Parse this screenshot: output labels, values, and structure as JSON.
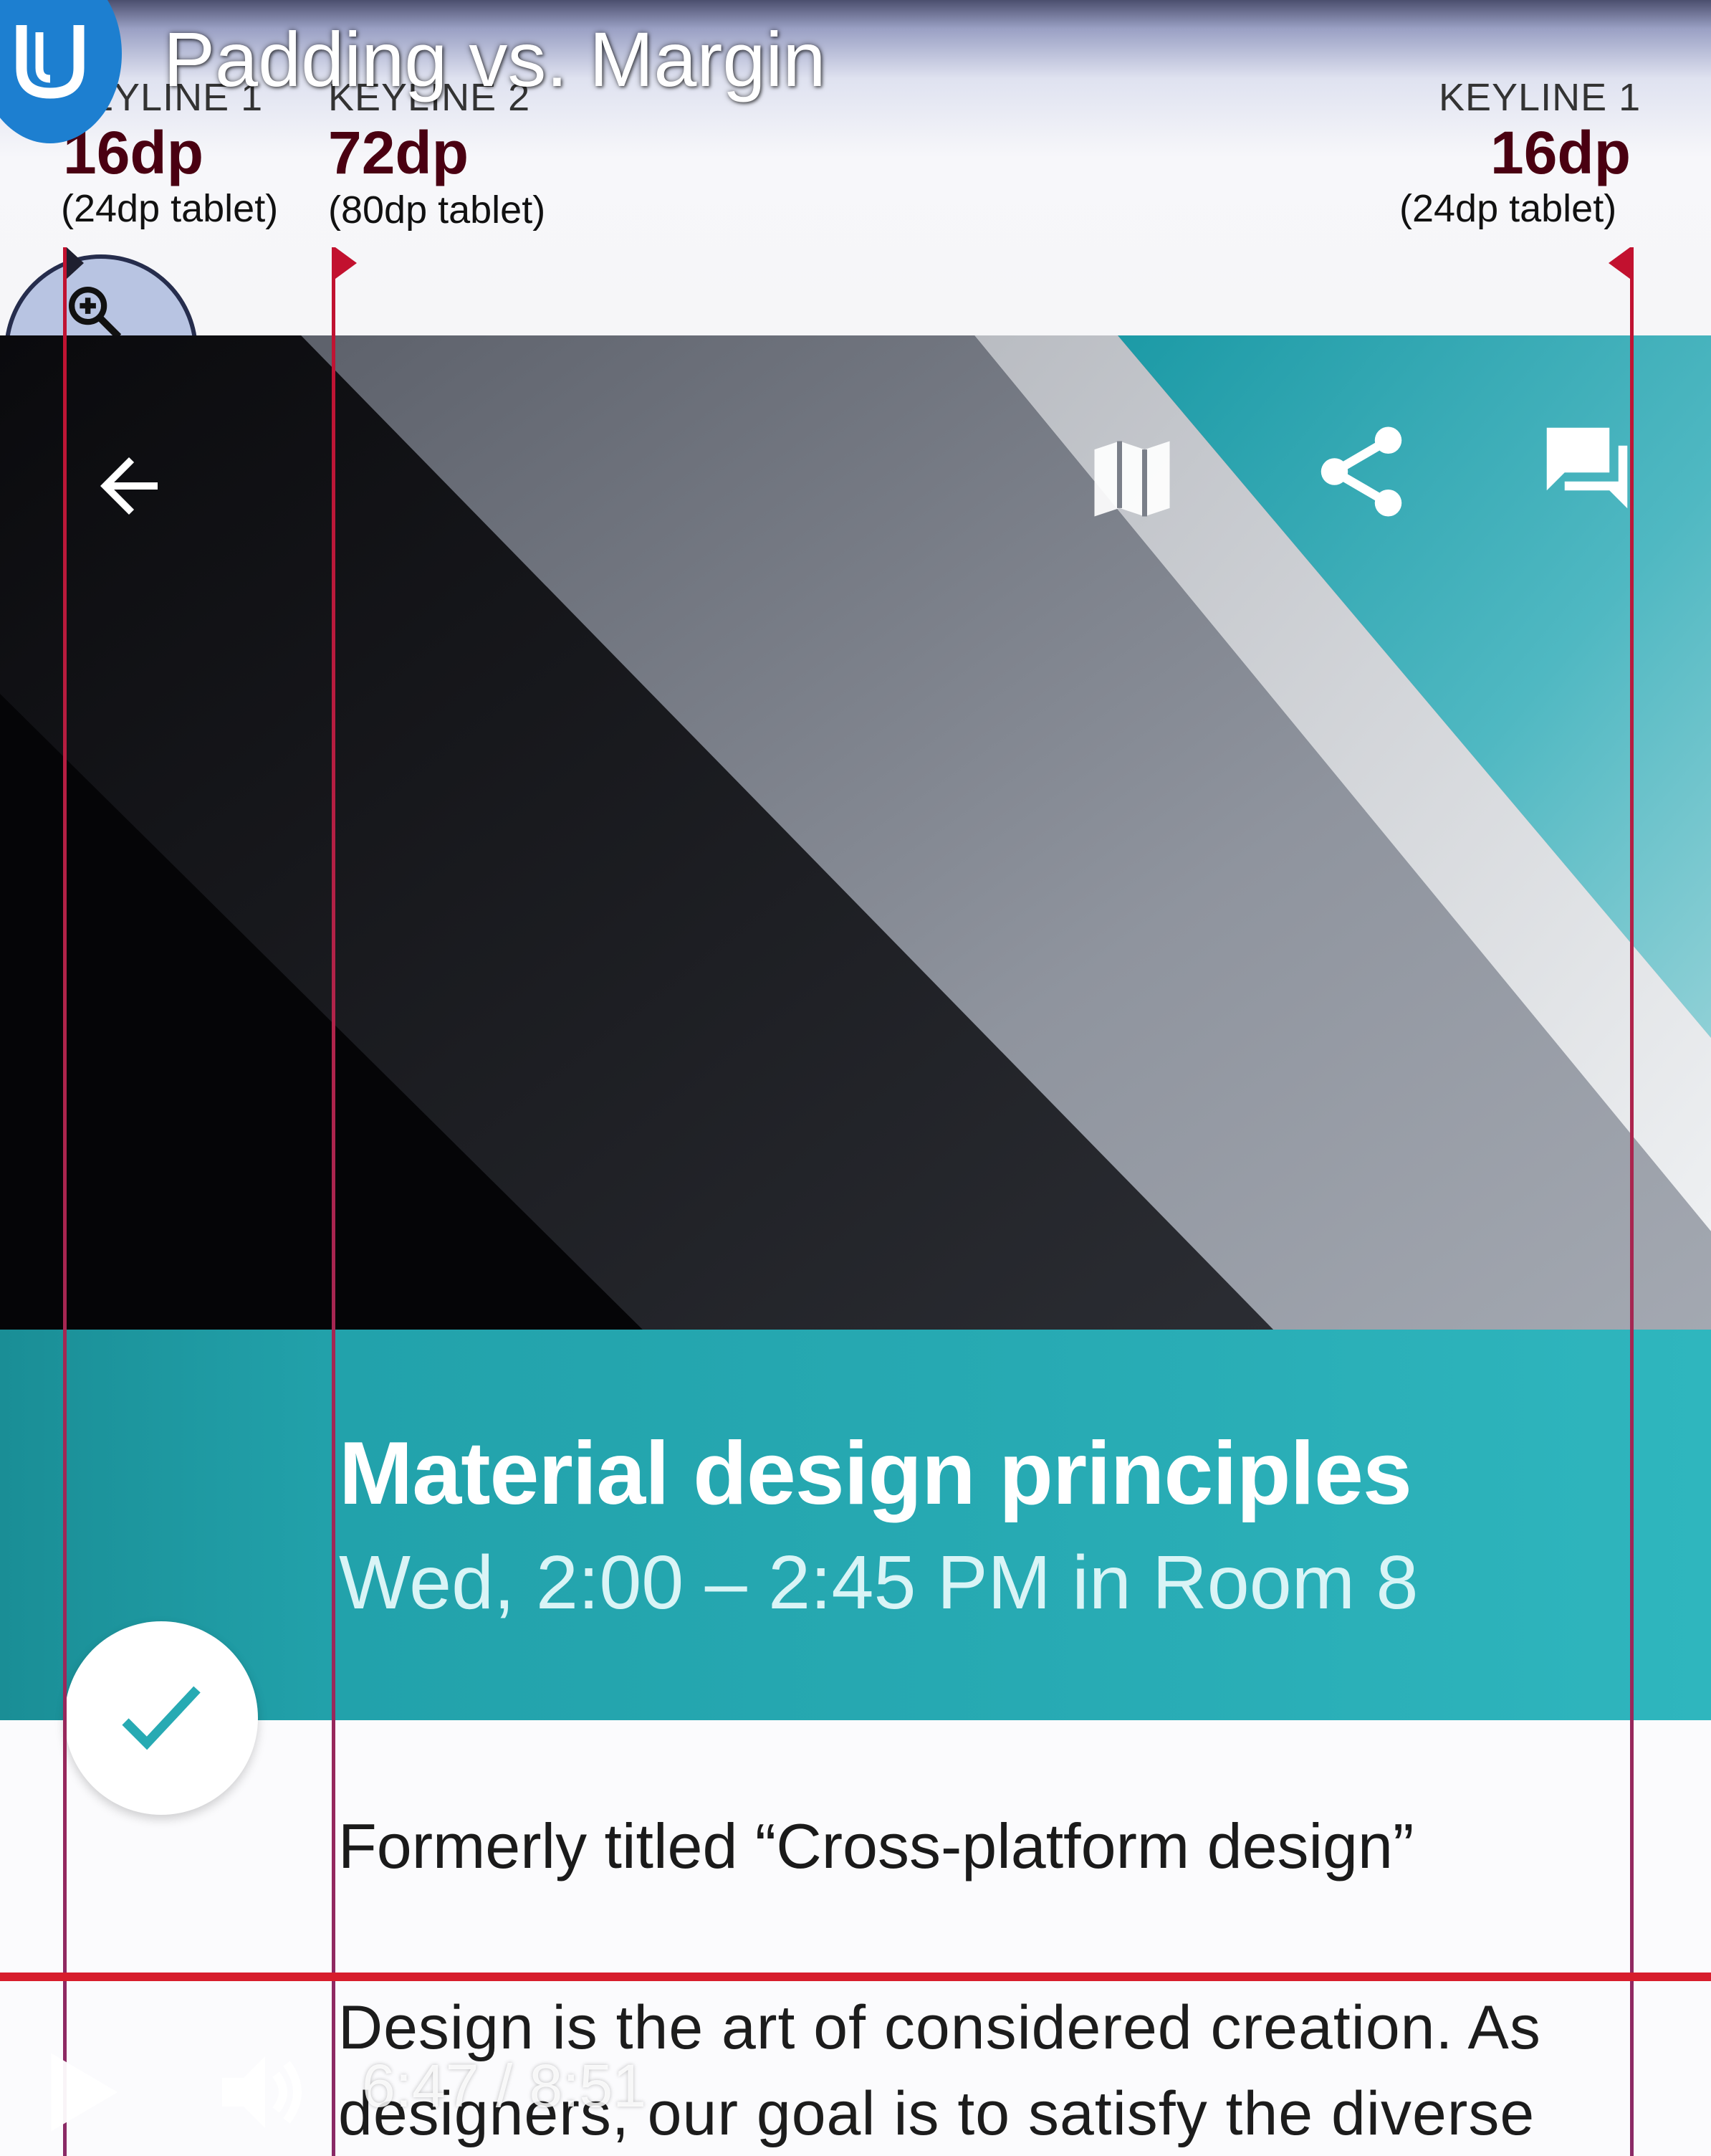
{
  "video": {
    "title": "Padding vs. Margin",
    "time_display": "6:47 / 8:51"
  },
  "keylines": {
    "left": {
      "label": "KEYLINE 1",
      "dp": "16dp",
      "tablet": "(24dp tablet)"
    },
    "middle": {
      "label": "KEYLINE 2",
      "dp": "72dp",
      "tablet": "(80dp tablet)"
    },
    "right": {
      "label": "KEYLINE 1",
      "dp": "16dp",
      "tablet": "(24dp tablet)"
    }
  },
  "appbar": {
    "icons": [
      "back-arrow-icon",
      "map-icon",
      "share-icon",
      "chat-icon"
    ]
  },
  "session": {
    "title": "Material design principles",
    "time": "Wed, 2:00 – 2:45 PM in Room 8",
    "formerly": "Formerly titled “Cross-platform design”",
    "description_lines": [
      "Design is the art of considered creation. As",
      "designers, our goal is to satisfy the diverse"
    ]
  },
  "colors": {
    "teal": "#27aab3",
    "keyline_red": "#c2112f",
    "udacity_blue": "#1d7fd0"
  }
}
